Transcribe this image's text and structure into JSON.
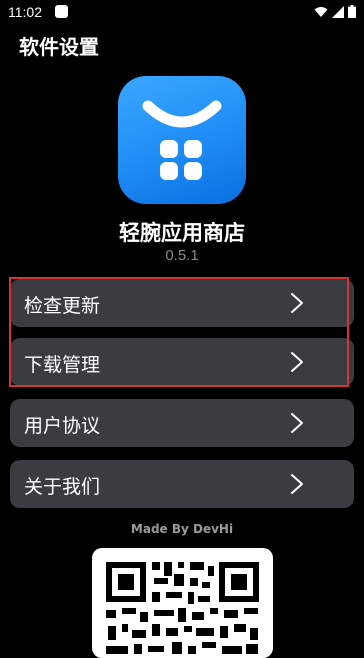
{
  "status_bar": {
    "time": "11:02"
  },
  "page": {
    "title": "软件设置"
  },
  "app": {
    "name": "轻腕应用商店",
    "version": "0.5.1"
  },
  "menu": [
    {
      "label": "检查更新"
    },
    {
      "label": "下载管理"
    },
    {
      "label": "用户协议"
    },
    {
      "label": "关于我们"
    }
  ],
  "footer": {
    "made_by": "Made By DevHi"
  },
  "colors": {
    "background": "#000000",
    "card": "#3a3c40",
    "highlight": "#d43434",
    "icon_blue": "#1f8cf5"
  }
}
